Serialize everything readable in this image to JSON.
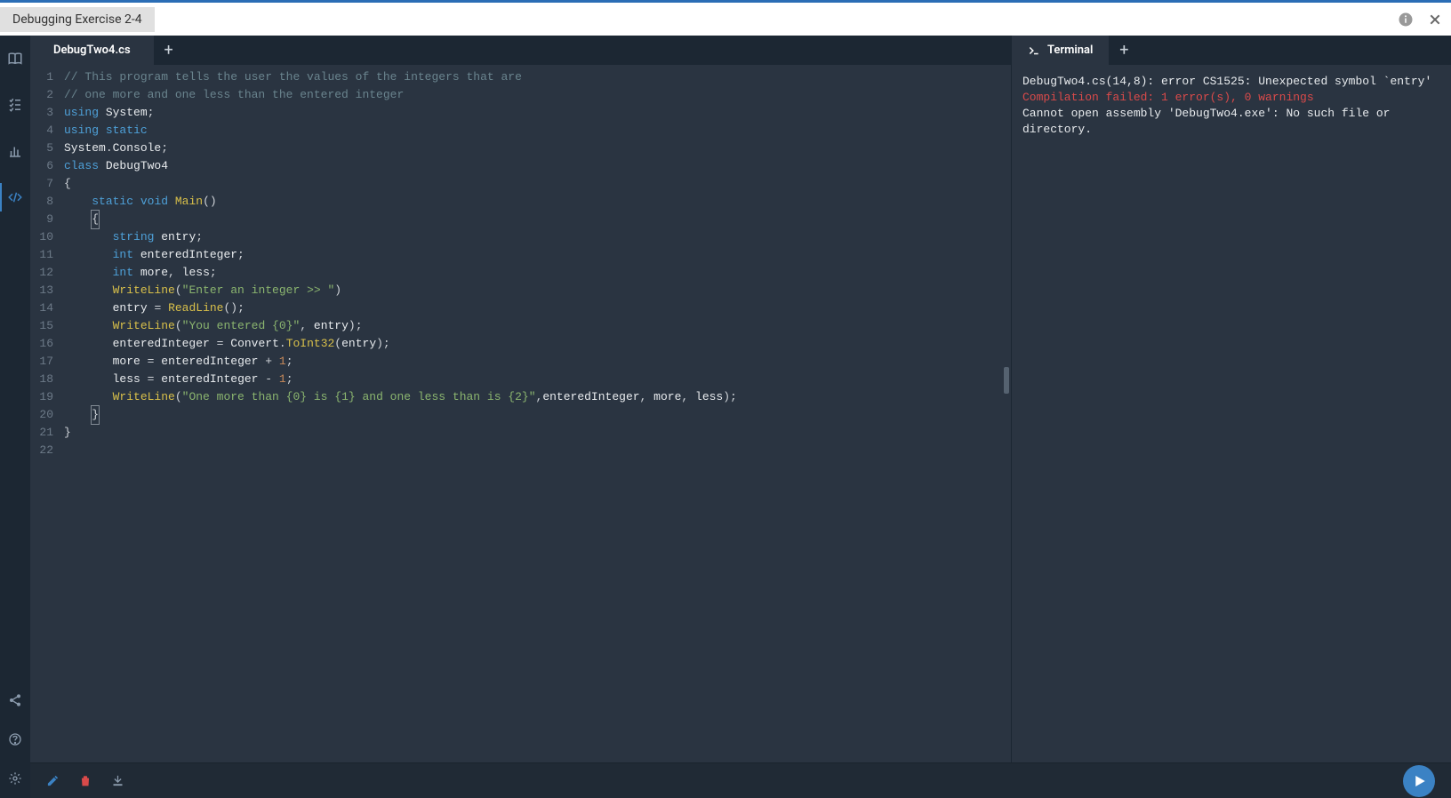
{
  "header": {
    "title": "Debugging Exercise 2-4"
  },
  "editor": {
    "tab_label": "DebugTwo4.cs",
    "lines": [
      {
        "n": 1,
        "html": "<span class='tok-comment'>// This program tells the user the values of the integers that are</span>"
      },
      {
        "n": 2,
        "html": "<span class='tok-comment'>// one more and one less than the entered integer</span>"
      },
      {
        "n": 3,
        "html": "<span class='tok-keyword'>using</span> <span class='tok-ident'>System</span><span class='tok-punct'>;</span>"
      },
      {
        "n": 4,
        "html": "<span class='tok-keyword'>using</span> <span class='tok-keyword'>static</span>"
      },
      {
        "n": 5,
        "html": "<span class='tok-ident'>System</span><span class='tok-punct'>.</span><span class='tok-ident'>Console</span><span class='tok-punct'>;</span>"
      },
      {
        "n": 6,
        "html": "<span class='tok-keyword'>class</span> <span class='tok-ident'>DebugTwo4</span>"
      },
      {
        "n": 7,
        "html": "<span class='tok-punct'>{</span>"
      },
      {
        "n": 8,
        "html": "    <span class='tok-keyword'>static</span> <span class='tok-type'>void</span> <span class='tok-method'>Main</span><span class='tok-punct'>()</span>"
      },
      {
        "n": 9,
        "html": "    <span class='cursor-box tok-punct'>{</span>"
      },
      {
        "n": 10,
        "html": "       <span class='tok-type'>string</span> <span class='tok-ident'>entry</span><span class='tok-punct'>;</span>"
      },
      {
        "n": 11,
        "html": "       <span class='tok-type'>int</span> <span class='tok-ident'>enteredInteger</span><span class='tok-punct'>;</span>"
      },
      {
        "n": 12,
        "html": "       <span class='tok-type'>int</span> <span class='tok-ident'>more</span><span class='tok-punct'>,</span> <span class='tok-ident'>less</span><span class='tok-punct'>;</span>"
      },
      {
        "n": 13,
        "html": "       <span class='tok-method'>WriteLine</span><span class='tok-punct'>(</span><span class='tok-string'>\"Enter an integer >> \"</span><span class='tok-punct'>)</span>"
      },
      {
        "n": 14,
        "html": "       <span class='tok-ident'>entry</span> <span class='tok-punct'>=</span> <span class='tok-method'>ReadLine</span><span class='tok-punct'>();</span>"
      },
      {
        "n": 15,
        "html": "       <span class='tok-method'>WriteLine</span><span class='tok-punct'>(</span><span class='tok-string'>\"You entered {0}\"</span><span class='tok-punct'>,</span> <span class='tok-ident'>entry</span><span class='tok-punct'>);</span>"
      },
      {
        "n": 16,
        "html": "       <span class='tok-ident'>enteredInteger</span> <span class='tok-punct'>=</span> <span class='tok-ident'>Convert</span><span class='tok-punct'>.</span><span class='tok-method'>ToInt32</span><span class='tok-punct'>(</span><span class='tok-ident'>entry</span><span class='tok-punct'>);</span>"
      },
      {
        "n": 17,
        "html": "       <span class='tok-ident'>more</span> <span class='tok-punct'>=</span> <span class='tok-ident'>enteredInteger</span> <span class='tok-punct'>+</span> <span class='tok-num'>1</span><span class='tok-punct'>;</span>"
      },
      {
        "n": 18,
        "html": "       <span class='tok-ident'>less</span> <span class='tok-punct'>=</span> <span class='tok-ident'>enteredInteger</span> <span class='tok-punct'>-</span> <span class='tok-num'>1</span><span class='tok-punct'>;</span>"
      },
      {
        "n": 19,
        "html": "       <span class='tok-method'>WriteLine</span><span class='tok-punct'>(</span><span class='tok-string'>\"One more than {0} is {1} and one less than is {2}\"</span><span class='tok-punct'>,</span><span class='tok-ident'>enteredInteger</span><span class='tok-punct'>,</span> <span class='tok-ident'>more</span><span class='tok-punct'>,</span> <span class='tok-ident'>less</span><span class='tok-punct'>);</span>"
      },
      {
        "n": 20,
        "html": "    <span class='cursor-box tok-punct'>}</span>"
      },
      {
        "n": 21,
        "html": "<span class='tok-punct'>}</span>"
      },
      {
        "n": 22,
        "html": ""
      }
    ]
  },
  "terminal": {
    "tab_label": "Terminal",
    "lines": [
      {
        "text": "DebugTwo4.cs(14,8): error CS1525: Unexpected symbol `entry'",
        "cls": ""
      },
      {
        "text": "Compilation failed: 1 error(s), 0 warnings",
        "cls": "err"
      },
      {
        "text": "Cannot open assembly 'DebugTwo4.exe': No such file or directory.",
        "cls": ""
      }
    ]
  }
}
